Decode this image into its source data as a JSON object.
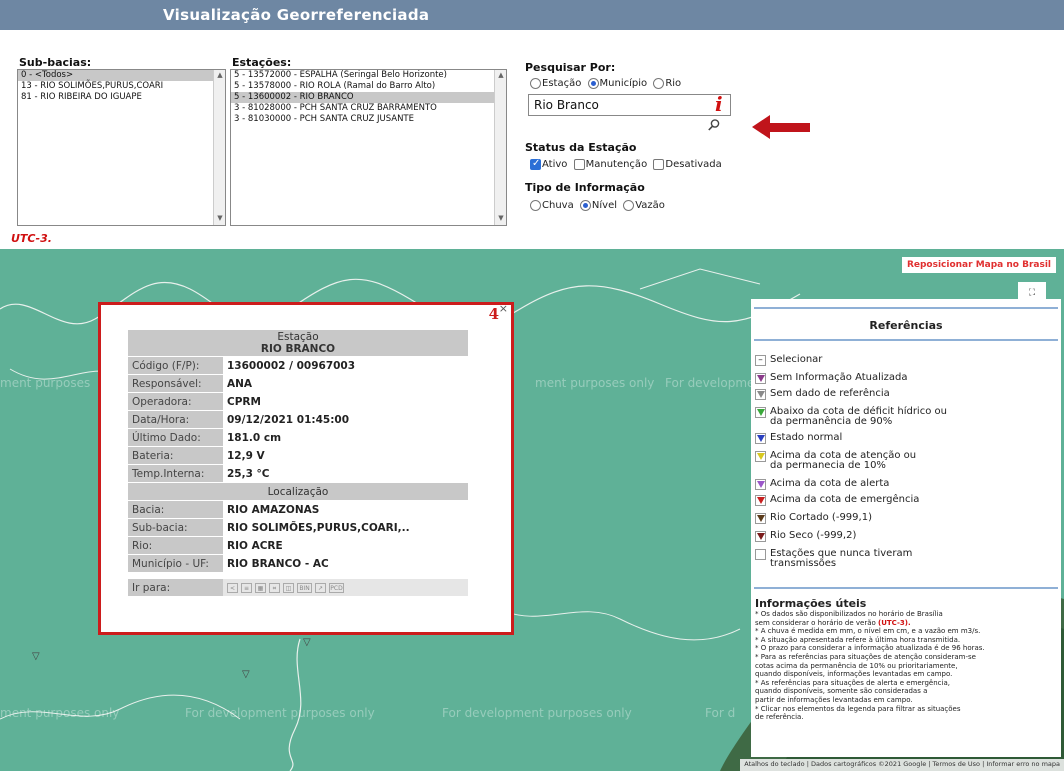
{
  "title": "Visualização Georreferenciada",
  "subbacias": {
    "label": "Sub-bacias:",
    "items": [
      "0 - <Todos>",
      "13 - RIO SOLIMÕES,PURUS,COARI",
      "81 - RIO RIBEIRA DO IGUAPE"
    ]
  },
  "estacoes": {
    "label": "Estações:",
    "items": [
      "5 - 13572000 - ESPALHA (Seringal Belo Horizonte)",
      "5 - 13578000 - RIO ROLA (Ramal do Barro Alto)",
      "5 - 13600002 - RIO BRANCO",
      "3 - 81028000 - PCH SANTA CRUZ BARRAMENTO",
      "3 - 81030000 - PCH SANTA CRUZ JUSANTE"
    ]
  },
  "pesquisar": {
    "label": "Pesquisar Por:",
    "options": [
      "Estação",
      "Município",
      "Rio"
    ],
    "selected": "Município",
    "value": "Rio Branco",
    "info_mark": "i"
  },
  "status": {
    "label": "Status da Estação",
    "options": [
      "Ativo",
      "Manutenção",
      "Desativada"
    ],
    "checked": [
      "Ativo"
    ]
  },
  "tipo": {
    "label": "Tipo de Informação",
    "options": [
      "Chuva",
      "Nível",
      "Vazão"
    ],
    "selected": "Nível"
  },
  "utc_note": "UTC-3.",
  "map": {
    "reposition_button": "Reposicionar Mapa no Brasil",
    "fullscreen_icon": "fullscreen-icon",
    "watermark": "For development purposes only",
    "watermark_fragment_1": "ment purposes",
    "watermark_fragment_2": "ment purposes only",
    "watermark_fragment_3": "For d",
    "attribution": [
      "Atalhos do teclado",
      "Dados cartográficos ©2021 Google",
      "Termos de Uso",
      "Informar erro no mapa"
    ]
  },
  "popup": {
    "annotation_number": "4",
    "close_glyph": "×",
    "header": "Estação",
    "station_name": "RIO BRANCO",
    "fields": [
      {
        "k": "Código (F/P):",
        "v": "13600002 / 00967003"
      },
      {
        "k": "Responsável:",
        "v": "ANA"
      },
      {
        "k": "Operadora:",
        "v": "CPRM"
      },
      {
        "k": "Data/Hora:",
        "v": "09/12/2021 01:45:00"
      },
      {
        "k": "Último Dado:",
        "v": "181.0 cm"
      },
      {
        "k": "Bateria:",
        "v": "12,9 V"
      },
      {
        "k": "Temp.Interna:",
        "v": "25,3 °C"
      }
    ],
    "loc_header": "Localização",
    "loc_fields": [
      {
        "k": "Bacia:",
        "v": "RIO AMAZONAS"
      },
      {
        "k": "Sub-bacia:",
        "v": "RIO SOLIMÕES,PURUS,COARI,.."
      },
      {
        "k": "Rio:",
        "v": "RIO ACRE"
      },
      {
        "k": "Município - UF:",
        "v": "RIO BRANCO - AC"
      }
    ],
    "goto_label": "Ir para:",
    "goto_icons": [
      "share-icon",
      "list-icon",
      "calendar-icon",
      "chart-icon",
      "database-icon",
      "bin-icon",
      "export-icon",
      "pcd-icon"
    ]
  },
  "legend": {
    "title": "Referências",
    "items": [
      {
        "text": "Selecionar",
        "color": ""
      },
      {
        "text": "Sem Informação Atualizada",
        "color": "#8a3a8a"
      },
      {
        "text": "Sem dado de referência",
        "color": "#8a8a8a"
      },
      {
        "text": "Abaixo da cota de déficit hídrico ou\nda permanência de 90%",
        "color": "#3aa83a"
      },
      {
        "text": "Estado normal",
        "color": "#2a3fbf"
      },
      {
        "text": "Acima da cota de atenção ou\nda permanecia de 10%",
        "color": "#d8c820"
      },
      {
        "text": "Acima da cota de alerta",
        "color": "#9b57c9"
      },
      {
        "text": "Acima da cota de emergência",
        "color": "#c81e1e"
      },
      {
        "text": "Rio Cortado (-999,1)",
        "color": "#5a3a1a"
      },
      {
        "text": "Rio Seco (-999,2)",
        "color": "#7a1a1a"
      },
      {
        "text": "Estações que nunca tiveram\ntransmissões",
        "color": ""
      }
    ],
    "info_title": "Informações úteis",
    "notes": [
      "* Os dados são disponibilizados no horário de Brasília",
      "sem considerar o horário de verão",
      "(UTC-3).",
      "* A chuva é medida em mm, o nível em cm, e a vazão em m3/s.",
      "* A situação apresentada refere à última hora transmitida.",
      "* O prazo para considerar a informação atualizada é de 96 horas.",
      "* Para as referências para situações de atenção consideram-se",
      "cotas acima da permanência de 10% ou prioritariamente,",
      "quando disponíveis, informações levantadas em campo.",
      "* As referências para situações de alerta e emergência,",
      "quando disponíveis, somente são consideradas a",
      "partir de informações levantadas em campo.",
      "* Clicar nos elementos da legenda para filtrar as situações",
      "de referência."
    ]
  },
  "colors": {
    "titlebar": "#6e87a3",
    "map_water": "#5fb197",
    "popup_border": "#cc1c1c",
    "arrow": "#c0141b"
  }
}
